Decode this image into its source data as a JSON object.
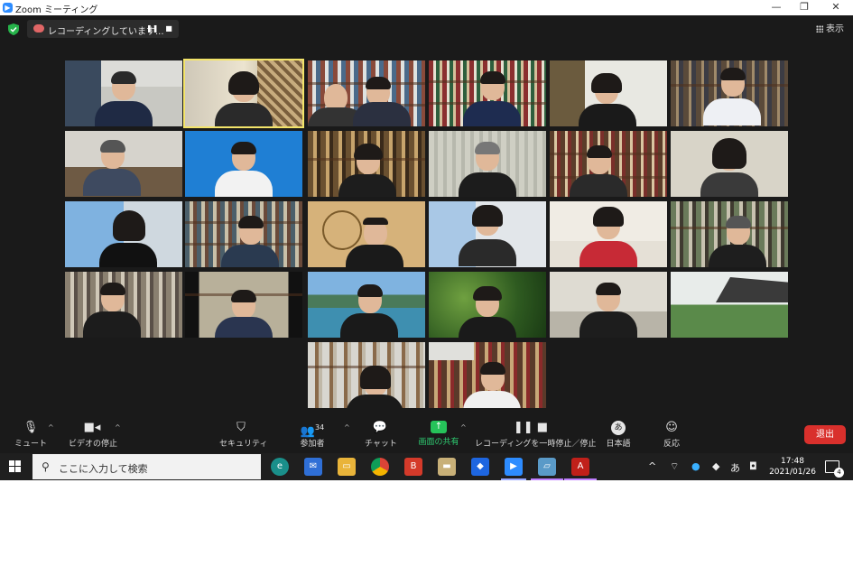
{
  "window": {
    "title": "Zoom ミーティング",
    "logo_icon": "zoom-icon"
  },
  "recording_bar": {
    "label": "レコーディングしています..."
  },
  "view_button": {
    "label": "表示"
  },
  "participants_count": "34",
  "toolbar": {
    "mute": "ミュート",
    "video": "ビデオの停止",
    "security": "セキュリティ",
    "participants": "参加者",
    "chat": "チャット",
    "share": "画面の共有",
    "recording": "レコーディングを一時停止／停止",
    "language": "日本語",
    "reactions": "反応",
    "leave": "退出",
    "share_color": "#2ecc71",
    "leave_color": "#d9302c"
  },
  "taskbar": {
    "search_placeholder": "ここに入力して検索",
    "time": "17:48",
    "date": "2021/01/26",
    "ime_label": "あ",
    "notification_count": "4"
  }
}
